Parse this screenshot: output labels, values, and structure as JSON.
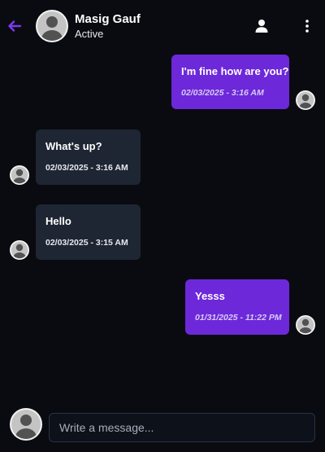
{
  "header": {
    "contact_name": "Masig Gauf",
    "contact_status": "Active",
    "back_icon": "arrow-left-icon",
    "profile_icon": "user-icon",
    "menu_icon": "more-vertical-icon"
  },
  "messages": [
    {
      "direction": "sent",
      "text": "I'm fine how are you?",
      "time": "02/03/2025 - 3:16 AM"
    },
    {
      "direction": "received",
      "text": "What's up?",
      "time": "02/03/2025 - 3:16 AM"
    },
    {
      "direction": "received",
      "text": "Hello",
      "time": "02/03/2025 - 3:15 AM"
    },
    {
      "direction": "sent",
      "text": "Yesss",
      "time": "01/31/2025 - 11:22 PM"
    }
  ],
  "composer": {
    "placeholder": "Write a message...",
    "value": ""
  },
  "colors": {
    "accent": "#6d28d9",
    "background": "#090b11",
    "received_bubble": "#1f2633",
    "back_icon": "#7c3aed"
  }
}
